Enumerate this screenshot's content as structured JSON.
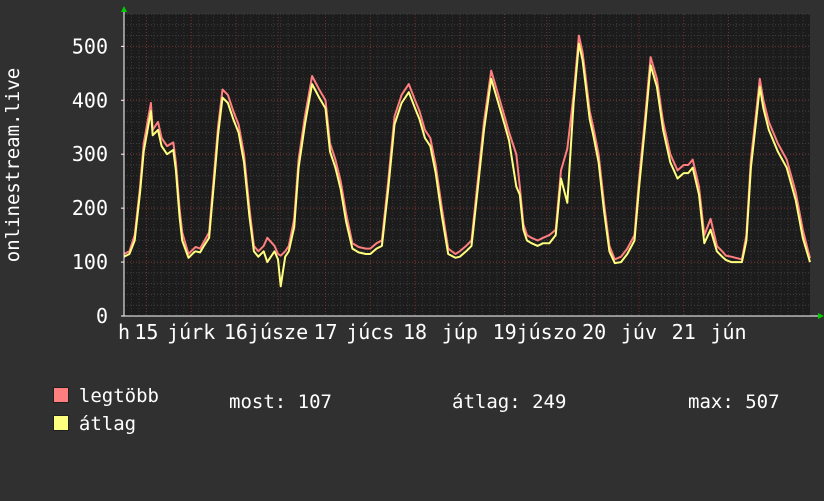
{
  "chart_data": {
    "type": "line",
    "ylabel": "onlinestream.live",
    "ylim": [
      0,
      560
    ],
    "yticks": [
      0,
      100,
      200,
      300,
      400,
      500
    ],
    "xlim": [
      0,
      7.66
    ],
    "xticks": [
      {
        "x": 0.0,
        "label": "h"
      },
      {
        "x": 0.25,
        "label": "15"
      },
      {
        "x": 0.75,
        "label": "júrk"
      },
      {
        "x": 1.25,
        "label": "16"
      },
      {
        "x": 1.72,
        "label": "júsze"
      },
      {
        "x": 2.25,
        "label": "17"
      },
      {
        "x": 2.75,
        "label": "júcs"
      },
      {
        "x": 3.25,
        "label": "18"
      },
      {
        "x": 3.75,
        "label": "júp"
      },
      {
        "x": 4.25,
        "label": "19"
      },
      {
        "x": 4.72,
        "label": "júszo"
      },
      {
        "x": 5.25,
        "label": "20"
      },
      {
        "x": 5.75,
        "label": "júv"
      },
      {
        "x": 6.25,
        "label": "21"
      },
      {
        "x": 6.75,
        "label": "jún"
      }
    ],
    "grid": true,
    "series": [
      {
        "name": "legtöbb",
        "color": "#ff7f7f",
        "x": [
          0,
          0.06,
          0.12,
          0.18,
          0.22,
          0.3,
          0.32,
          0.38,
          0.42,
          0.48,
          0.55,
          0.58,
          0.62,
          0.65,
          0.72,
          0.78,
          0.8,
          0.85,
          0.9,
          0.95,
          1.02,
          1.05,
          1.1,
          1.16,
          1.22,
          1.28,
          1.34,
          1.4,
          1.45,
          1.5,
          1.56,
          1.6,
          1.68,
          1.72,
          1.75,
          1.8,
          1.84,
          1.9,
          1.95,
          2.02,
          2.1,
          2.18,
          2.25,
          2.3,
          2.36,
          2.42,
          2.48,
          2.55,
          2.62,
          2.7,
          2.75,
          2.82,
          2.88,
          2.95,
          3.02,
          3.1,
          3.18,
          3.25,
          3.3,
          3.36,
          3.42,
          3.48,
          3.55,
          3.62,
          3.7,
          3.75,
          3.82,
          3.88,
          3.95,
          4.02,
          4.1,
          4.18,
          4.25,
          4.3,
          4.38,
          4.42,
          4.46,
          4.5,
          4.55,
          4.62,
          4.68,
          4.75,
          4.82,
          4.88,
          4.95,
          5.02,
          5.08,
          5.12,
          5.15,
          5.2,
          5.24,
          5.3,
          5.36,
          5.42,
          5.48,
          5.55,
          5.62,
          5.7,
          5.75,
          5.82,
          5.88,
          5.95,
          6.02,
          6.1,
          6.18,
          6.25,
          6.3,
          6.35,
          6.42,
          6.48,
          6.55,
          6.62,
          6.68,
          6.72,
          6.78,
          6.85,
          6.9,
          6.95,
          7.0,
          7.06,
          7.1,
          7.14,
          7.2,
          7.3,
          7.4,
          7.5,
          7.58,
          7.66
        ],
        "y": [
          115,
          120,
          150,
          240,
          320,
          395,
          345,
          360,
          330,
          315,
          322,
          285,
          200,
          155,
          115,
          125,
          128,
          125,
          140,
          155,
          290,
          350,
          420,
          410,
          380,
          355,
          300,
          200,
          130,
          120,
          130,
          145,
          130,
          115,
          112,
          120,
          130,
          180,
          290,
          370,
          445,
          420,
          400,
          320,
          290,
          250,
          190,
          135,
          128,
          125,
          125,
          135,
          140,
          250,
          370,
          410,
          430,
          400,
          380,
          345,
          330,
          280,
          200,
          125,
          115,
          120,
          130,
          140,
          250,
          360,
          455,
          410,
          370,
          340,
          300,
          240,
          170,
          150,
          145,
          140,
          145,
          150,
          160,
          270,
          310,
          410,
          520,
          490,
          450,
          380,
          350,
          300,
          210,
          130,
          105,
          110,
          125,
          150,
          250,
          370,
          480,
          440,
          360,
          300,
          270,
          280,
          280,
          290,
          240,
          150,
          180,
          130,
          120,
          112,
          110,
          107,
          105,
          150,
          290,
          380,
          440,
          400,
          360,
          320,
          290,
          230,
          160,
          107
        ]
      },
      {
        "name": "átlag",
        "color": "#ffff7f",
        "x": [
          0,
          0.06,
          0.12,
          0.18,
          0.22,
          0.3,
          0.32,
          0.38,
          0.42,
          0.48,
          0.55,
          0.58,
          0.62,
          0.65,
          0.72,
          0.78,
          0.8,
          0.85,
          0.9,
          0.95,
          1.02,
          1.05,
          1.1,
          1.16,
          1.22,
          1.28,
          1.34,
          1.4,
          1.45,
          1.5,
          1.56,
          1.6,
          1.68,
          1.72,
          1.75,
          1.8,
          1.84,
          1.9,
          1.95,
          2.02,
          2.1,
          2.18,
          2.25,
          2.3,
          2.36,
          2.42,
          2.48,
          2.55,
          2.62,
          2.7,
          2.75,
          2.82,
          2.88,
          2.95,
          3.02,
          3.1,
          3.18,
          3.25,
          3.3,
          3.36,
          3.42,
          3.48,
          3.55,
          3.62,
          3.7,
          3.75,
          3.82,
          3.88,
          3.95,
          4.02,
          4.1,
          4.18,
          4.25,
          4.3,
          4.38,
          4.42,
          4.46,
          4.5,
          4.55,
          4.62,
          4.68,
          4.75,
          4.82,
          4.88,
          4.95,
          5.02,
          5.08,
          5.12,
          5.15,
          5.2,
          5.24,
          5.3,
          5.36,
          5.42,
          5.48,
          5.55,
          5.62,
          5.7,
          5.75,
          5.82,
          5.88,
          5.95,
          6.02,
          6.1,
          6.18,
          6.25,
          6.3,
          6.35,
          6.42,
          6.48,
          6.55,
          6.62,
          6.68,
          6.72,
          6.78,
          6.85,
          6.9,
          6.95,
          7.0,
          7.06,
          7.1,
          7.14,
          7.2,
          7.3,
          7.4,
          7.5,
          7.58,
          7.66
        ],
        "y": [
          110,
          115,
          140,
          230,
          305,
          380,
          335,
          345,
          315,
          300,
          308,
          270,
          185,
          140,
          108,
          118,
          120,
          118,
          132,
          145,
          275,
          335,
          405,
          395,
          365,
          340,
          285,
          185,
          120,
          110,
          120,
          100,
          120,
          105,
          55,
          110,
          120,
          165,
          275,
          355,
          430,
          405,
          385,
          305,
          275,
          235,
          175,
          125,
          118,
          115,
          115,
          125,
          130,
          235,
          355,
          395,
          415,
          385,
          365,
          330,
          315,
          265,
          185,
          115,
          108,
          110,
          120,
          130,
          235,
          345,
          440,
          395,
          355,
          325,
          240,
          225,
          160,
          140,
          135,
          130,
          135,
          135,
          150,
          255,
          210,
          395,
          505,
          475,
          435,
          365,
          335,
          285,
          195,
          120,
          98,
          100,
          115,
          140,
          235,
          355,
          465,
          425,
          345,
          285,
          255,
          265,
          265,
          275,
          225,
          135,
          160,
          120,
          110,
          104,
          100,
          100,
          100,
          140,
          275,
          365,
          425,
          385,
          345,
          305,
          275,
          215,
          145,
          100
        ]
      }
    ]
  },
  "legend": {
    "max_label": "legtöbb",
    "avg_label": "átlag",
    "max_color": "#ff7f7f",
    "avg_color": "#ffff7f",
    "most_text": "most: 107",
    "avg_text": "átlag: 249",
    "max_text": "max: 507"
  }
}
